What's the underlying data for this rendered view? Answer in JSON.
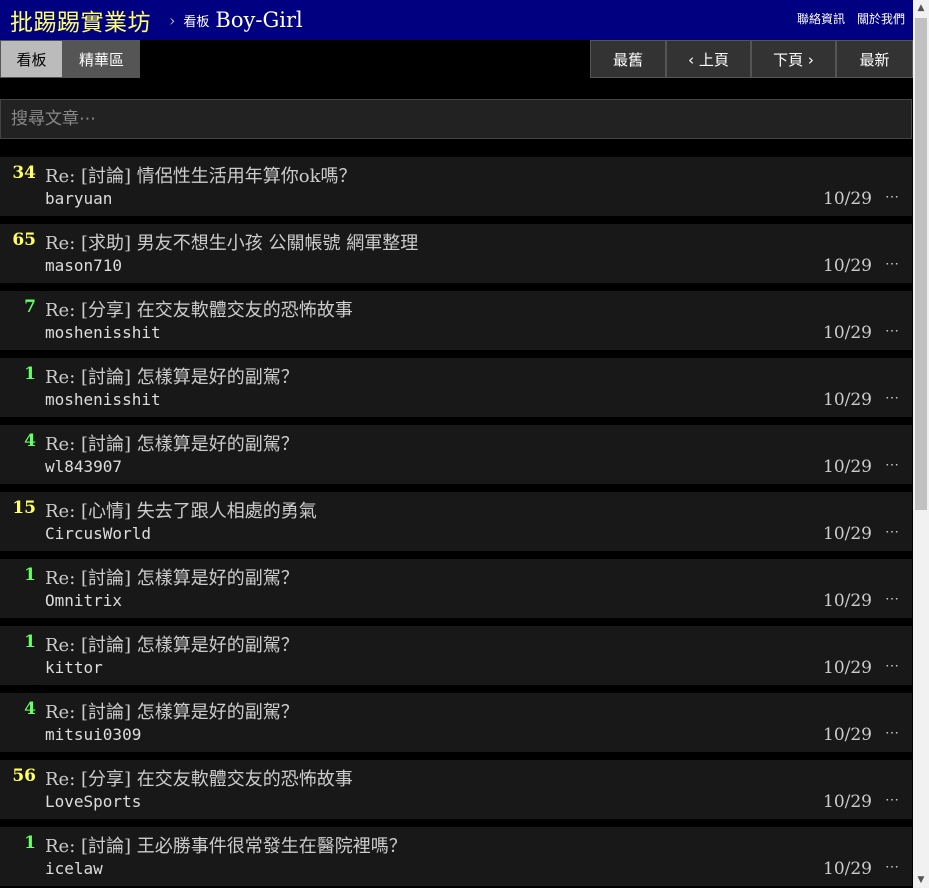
{
  "header": {
    "site_name": "批踢踢實業坊",
    "separator": "›",
    "board_label": "看板",
    "board_name": "Boy-Girl",
    "links": [
      "聯絡資訊",
      "關於我們"
    ]
  },
  "nav": {
    "board_tab": "看板",
    "digest_tab": "精華區",
    "oldest": "最舊",
    "prev": "‹ 上頁",
    "next": "下頁 ›",
    "newest": "最新"
  },
  "search": {
    "placeholder": "搜尋文章⋯"
  },
  "colors": {
    "recommend_high": "#ffff66",
    "recommend_low": "#66ff66",
    "background": "#000000",
    "header_bg": "#000080"
  },
  "posts": [
    {
      "recommend": "34",
      "title": "Re: [討論] 情侶性生活用年算你ok嗎？",
      "author": "baryuan",
      "date": "10/29",
      "more": "⋯"
    },
    {
      "recommend": "65",
      "title": "Re: [求助] 男友不想生小孩 公關帳號 網軍整理",
      "author": "mason710",
      "date": "10/29",
      "more": "⋯"
    },
    {
      "recommend": "7",
      "title": "Re: [分享] 在交友軟體交友的恐怖故事",
      "author": "moshenisshit",
      "date": "10/29",
      "more": "⋯"
    },
    {
      "recommend": "1",
      "title": "Re: [討論] 怎樣算是好的副駕？",
      "author": "moshenisshit",
      "date": "10/29",
      "more": "⋯"
    },
    {
      "recommend": "4",
      "title": "Re: [討論] 怎樣算是好的副駕？",
      "author": "wl843907",
      "date": "10/29",
      "more": "⋯"
    },
    {
      "recommend": "15",
      "title": "Re: [心情] 失去了跟人相處的勇氣",
      "author": "CircusWorld",
      "date": "10/29",
      "more": "⋯"
    },
    {
      "recommend": "1",
      "title": "Re: [討論] 怎樣算是好的副駕？",
      "author": "Omnitrix",
      "date": "10/29",
      "more": "⋯"
    },
    {
      "recommend": "1",
      "title": "Re: [討論] 怎樣算是好的副駕？",
      "author": "kittor",
      "date": "10/29",
      "more": "⋯"
    },
    {
      "recommend": "4",
      "title": "Re: [討論] 怎樣算是好的副駕？",
      "author": "mitsui0309",
      "date": "10/29",
      "more": "⋯"
    },
    {
      "recommend": "56",
      "title": "Re: [分享] 在交友軟體交友的恐怖故事",
      "author": "LoveSports",
      "date": "10/29",
      "more": "⋯"
    },
    {
      "recommend": "1",
      "title": "Re: [討論] 王必勝事件很常發生在醫院裡嗎？",
      "author": "icelaw",
      "date": "10/29",
      "more": "⋯"
    }
  ]
}
